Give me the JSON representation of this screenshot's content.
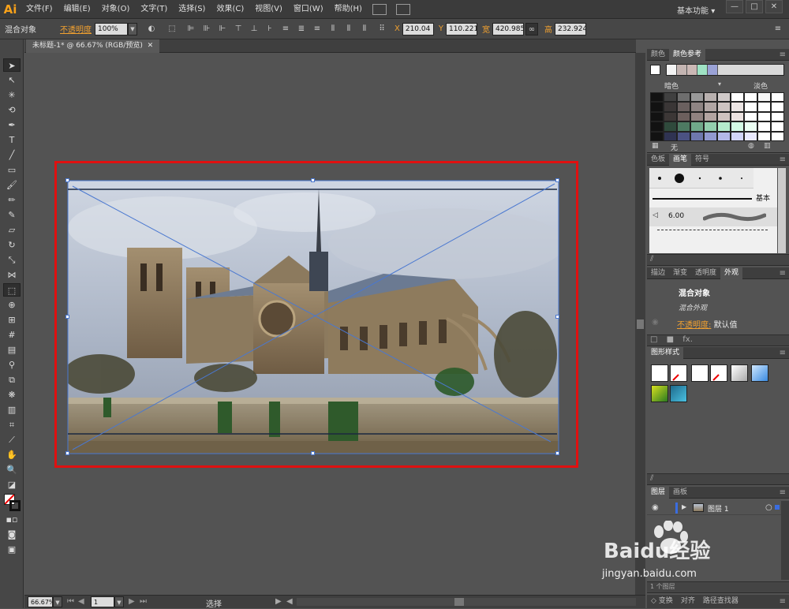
{
  "app": {
    "logo": "Ai",
    "workspace": "基本功能",
    "workspace_arrow": "▾"
  },
  "menu": [
    "文件(F)",
    "编辑(E)",
    "对象(O)",
    "文字(T)",
    "选择(S)",
    "效果(C)",
    "视图(V)",
    "窗口(W)",
    "帮助(H)"
  ],
  "window_buttons": [
    "—",
    "□",
    "✕"
  ],
  "control_bar": {
    "selection_label": "混合对象",
    "opacity_label": "不透明度",
    "opacity_value": "100%",
    "x_label": "X",
    "x_value": "210.04 m",
    "y_label": "Y",
    "y_value": "110.221",
    "w_label": "宽",
    "w_value": "420.985",
    "h_label": "高",
    "h_value": "232.924"
  },
  "document": {
    "tab_title": "未标题-1* @ 66.67% (RGB/预览)",
    "tab_close": "✕"
  },
  "status": {
    "zoom": "66.67%",
    "page": "1",
    "tool": "选择"
  },
  "color_panel": {
    "tabs": [
      "颜色",
      "颜色参考"
    ],
    "dark_label": "暗色",
    "light_label": "淡色",
    "none_label": "无",
    "ref_colors": [
      "#f3f3f3",
      "#c4b5b2",
      "#cbb8b5",
      "#9fe2c4",
      "#9aa2d6"
    ],
    "grid_colors": [
      [
        "#121212",
        "#404040",
        "#6e6e6e",
        "#9a9a9a",
        "#b8b0ae",
        "#cfc9c8",
        "#ffffff",
        "#ffffff",
        "#f6f6f6",
        "#ffffff"
      ],
      [
        "#121212",
        "#3a3636",
        "#6a605f",
        "#8e8483",
        "#b1a6a4",
        "#cdc3c1",
        "#ece5e4",
        "#ffffff",
        "#ffffff",
        "#ffffff"
      ],
      [
        "#121212",
        "#3c3736",
        "#6c5f5d",
        "#908280",
        "#b3a4a1",
        "#cfc2bf",
        "#ede3e1",
        "#ffffff",
        "#ffffff",
        "#ffffff"
      ],
      [
        "#121212",
        "#2f4a3c",
        "#4d7a62",
        "#70a88a",
        "#93cfae",
        "#b4ebcc",
        "#d4fbe6",
        "#ecfff4",
        "#ffffff",
        "#ffffff"
      ],
      [
        "#121212",
        "#2f3352",
        "#4b5282",
        "#6f78ad",
        "#9299d0",
        "#b3b8e8",
        "#d2d5f8",
        "#eaeaff",
        "#ffffff",
        "#ffffff"
      ]
    ]
  },
  "brush_panel": {
    "tabs": [
      "色板",
      "画笔",
      "符号"
    ],
    "basic_label": "基本",
    "size_label": "6.00"
  },
  "appearance_panel": {
    "tabs": [
      "描边",
      "渐变",
      "透明度",
      "外观"
    ],
    "title": "混合对象",
    "sub": "混合外观",
    "opacity_link": "不透明度:",
    "opacity_value": "默认值",
    "fx_label": "fx."
  },
  "graphic_styles_panel": {
    "tabs": [
      "图形样式"
    ]
  },
  "layers_panel": {
    "tabs": [
      "图层",
      "画板"
    ],
    "layer_name": "图层 1",
    "footer_label": "1 个图层"
  },
  "bottom_panel": {
    "tabs": [
      "变换",
      "对齐",
      "路径查找器"
    ]
  },
  "watermark": {
    "text": "Baidu经验",
    "url": "jingyan.baidu.com"
  }
}
